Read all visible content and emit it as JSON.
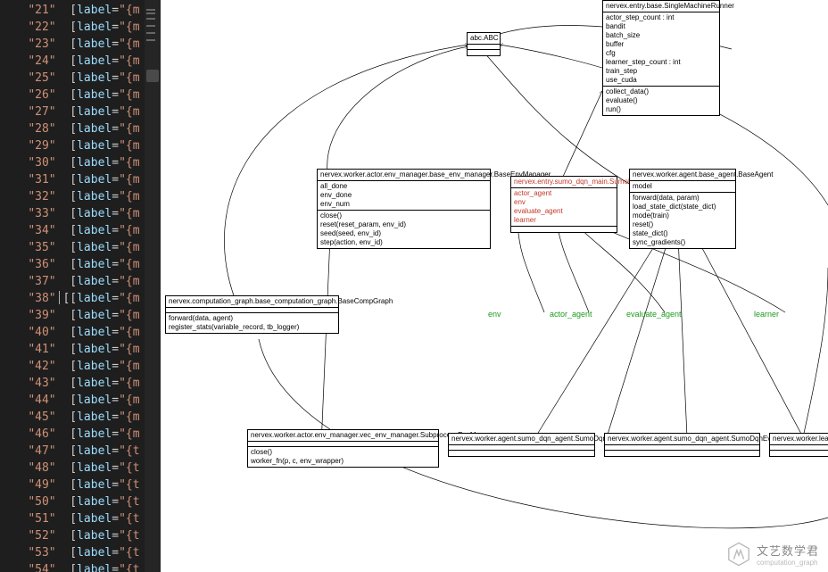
{
  "editor": {
    "lines": [
      {
        "num": "21",
        "tail": "{m"
      },
      {
        "num": "22",
        "tail": "{m"
      },
      {
        "num": "23",
        "tail": "{m"
      },
      {
        "num": "24",
        "tail": "{m"
      },
      {
        "num": "25",
        "tail": "{m"
      },
      {
        "num": "26",
        "tail": "{m"
      },
      {
        "num": "27",
        "tail": "{m"
      },
      {
        "num": "28",
        "tail": "{m"
      },
      {
        "num": "29",
        "tail": "{m"
      },
      {
        "num": "30",
        "tail": "{m"
      },
      {
        "num": "31",
        "tail": "{m"
      },
      {
        "num": "32",
        "tail": "{m"
      },
      {
        "num": "33",
        "tail": "{m"
      },
      {
        "num": "34",
        "tail": "{m"
      },
      {
        "num": "35",
        "tail": "{m"
      },
      {
        "num": "36",
        "tail": "{m"
      },
      {
        "num": "37",
        "tail": "{m"
      },
      {
        "num": "38",
        "tail": "{m"
      },
      {
        "num": "39",
        "tail": "{m"
      },
      {
        "num": "40",
        "tail": "{m"
      },
      {
        "num": "41",
        "tail": "{m"
      },
      {
        "num": "42",
        "tail": "{m"
      },
      {
        "num": "43",
        "tail": "{m"
      },
      {
        "num": "44",
        "tail": "{m"
      },
      {
        "num": "45",
        "tail": "{m"
      },
      {
        "num": "46",
        "tail": "{m"
      },
      {
        "num": "47",
        "tail": "{t"
      },
      {
        "num": "48",
        "tail": "{t"
      },
      {
        "num": "49",
        "tail": "{t"
      },
      {
        "num": "50",
        "tail": "{t"
      },
      {
        "num": "51",
        "tail": "{t"
      },
      {
        "num": "52",
        "tail": "{t"
      },
      {
        "num": "53",
        "tail": "{t"
      },
      {
        "num": "54",
        "tail": "{t"
      }
    ],
    "cursor_line_index": 17
  },
  "diagram": {
    "nodes": {
      "abc": {
        "title": "abc.ABC",
        "fields": [],
        "methods": []
      },
      "smr": {
        "title": "nervex.entry.base.SingleMachineRunner",
        "fields": [
          "actor_step_count : int",
          "bandit",
          "batch_size",
          "buffer",
          "cfg",
          "learner_step_count : int",
          "train_step",
          "use_cuda"
        ],
        "methods": [
          "collect_data()",
          "evaluate()",
          "run()"
        ]
      },
      "envmgr": {
        "title": "nervex.worker.actor.env_manager.base_env_manager.BaseEnvManager",
        "fields": [
          "all_done",
          "env_done",
          "env_num"
        ],
        "methods": [
          "close()",
          "reset(reset_param, env_id)",
          "seed(seed, env_id)",
          "step(action, env_id)"
        ]
      },
      "sumorunner": {
        "title": "nervex.entry.sumo_dqn_main.SumoRunner",
        "fields": [
          "actor_agent",
          "env",
          "evaluate_agent",
          "learner"
        ],
        "methods": []
      },
      "baseagent": {
        "title": "nervex.worker.agent.base_agent.BaseAgent",
        "fields": [
          "model"
        ],
        "methods": [
          "forward(data, param)",
          "load_state_dict(state_dict)",
          "mode(train)",
          "reset()",
          "state_dict()",
          "sync_gradients()"
        ]
      },
      "compgraph": {
        "title": "nervex.computation_graph.base_computation_graph.BaseCompGraph",
        "fields": [],
        "methods": [
          "forward(data, agent)",
          "register_stats(variable_record, tb_logger)"
        ]
      },
      "subenvmgr": {
        "title": "nervex.worker.actor.env_manager.vec_env_manager.SubprocessEnvManager",
        "fields": [],
        "methods": [
          "close()",
          "worker_fn(p, c, env_wrapper)"
        ]
      },
      "sumoactor": {
        "title": "nervex.worker.agent.sumo_dqn_agent.SumoDqnActorAgent",
        "fields": [],
        "methods": []
      },
      "sumoeval": {
        "title": "nervex.worker.agent.sumo_dqn_agent.SumoDqnEvaluateAgent",
        "fields": [],
        "methods": []
      },
      "sumolearner": {
        "title": "nervex.worker.learner.su",
        "fields": [],
        "methods": []
      }
    },
    "edge_labels": {
      "env": "env",
      "actor_agent": "actor_agent",
      "evaluate_agent": "evaluate_agent",
      "learner": "learner"
    }
  },
  "watermark": {
    "line1": "文艺数学君",
    "line2": "computation_graph"
  }
}
